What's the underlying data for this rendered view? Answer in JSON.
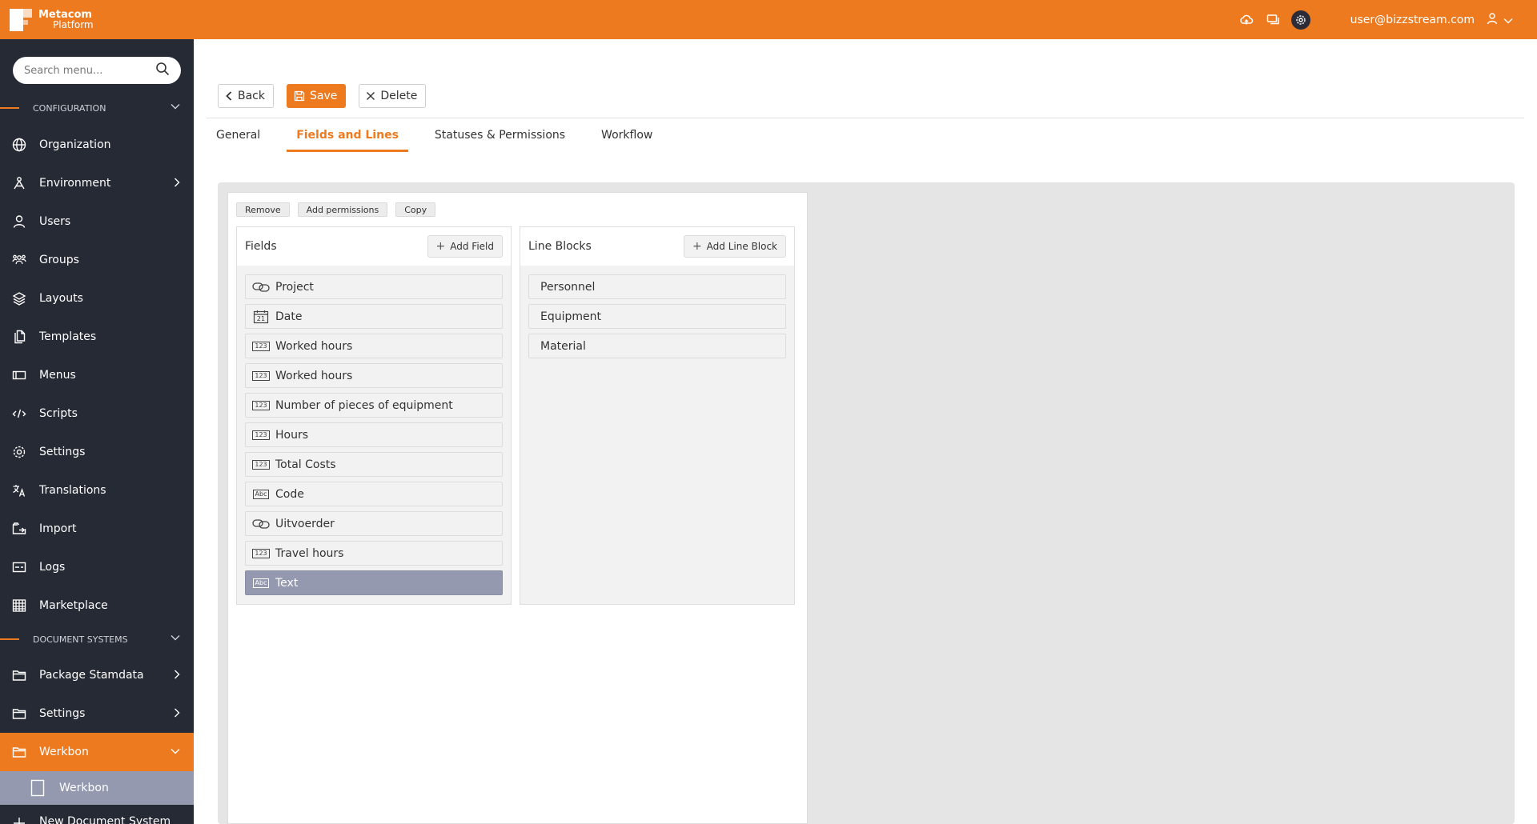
{
  "topbar": {
    "brand_line1": "Metacom",
    "brand_line2": "Platform",
    "user_email": "user@bizzstream.com",
    "accent_color": "#ee7a1f",
    "icons": [
      "cloud-upload-icon",
      "chat-icon",
      "gear-icon",
      "user-icon",
      "chevron-down-icon"
    ]
  },
  "sidebar": {
    "search_placeholder": "Search menu...",
    "section_configuration": "CONFIGURATION",
    "items": [
      {
        "label": "Organization",
        "icon": "globe-icon"
      },
      {
        "label": "Environment",
        "icon": "environment-icon"
      },
      {
        "label": "Users",
        "icon": "user-icon"
      },
      {
        "label": "Groups",
        "icon": "groups-icon"
      },
      {
        "label": "Layouts",
        "icon": "layers-icon"
      },
      {
        "label": "Templates",
        "icon": "templates-icon"
      },
      {
        "label": "Menus",
        "icon": "menus-icon"
      },
      {
        "label": "Scripts",
        "icon": "scripts-icon"
      },
      {
        "label": "Settings",
        "icon": "gear-icon"
      },
      {
        "label": "Translations",
        "icon": "translate-icon"
      },
      {
        "label": "Import",
        "icon": "import-icon"
      },
      {
        "label": "Logs",
        "icon": "logs-icon"
      },
      {
        "label": "Marketplace",
        "icon": "marketplace-icon"
      }
    ],
    "section_document_systems": "DOCUMENT SYSTEMS",
    "doc_items": [
      {
        "label": "Package Stamdata",
        "icon": "folder-icon"
      },
      {
        "label": "Settings",
        "icon": "folder-icon"
      },
      {
        "label": "Werkbon",
        "icon": "folder-icon"
      }
    ],
    "sub_item": "Werkbon",
    "partial_item": "New Document System"
  },
  "toolbar": {
    "back_label": "Back",
    "save_label": "Save",
    "delete_label": "Delete"
  },
  "tabs": [
    {
      "label": "General"
    },
    {
      "label": "Fields and Lines"
    },
    {
      "label": "Statuses & Permissions"
    },
    {
      "label": "Workflow"
    }
  ],
  "actions": {
    "remove": "Remove",
    "add_permissions": "Add permissions",
    "copy": "Copy"
  },
  "fields": {
    "title": "Fields",
    "add_label": "Add Field",
    "items": [
      {
        "label": "Project",
        "type": "link"
      },
      {
        "label": "Date",
        "type": "date"
      },
      {
        "label": "Worked hours",
        "type": "number"
      },
      {
        "label": "Worked hours",
        "type": "number"
      },
      {
        "label": "Number of pieces of equipment",
        "type": "number"
      },
      {
        "label": "Hours",
        "type": "number"
      },
      {
        "label": "Total Costs",
        "type": "number"
      },
      {
        "label": "Code",
        "type": "text"
      },
      {
        "label": "Uitvoerder",
        "type": "link"
      },
      {
        "label": "Travel hours",
        "type": "number"
      },
      {
        "label": "Text",
        "type": "text"
      }
    ]
  },
  "line_blocks": {
    "title": "Line Blocks",
    "add_label": "Add Line Block",
    "items": [
      {
        "label": "Personnel"
      },
      {
        "label": "Equipment"
      },
      {
        "label": "Material"
      }
    ]
  },
  "glyphs": {
    "number": "123",
    "text": "Abc",
    "date": "21"
  }
}
